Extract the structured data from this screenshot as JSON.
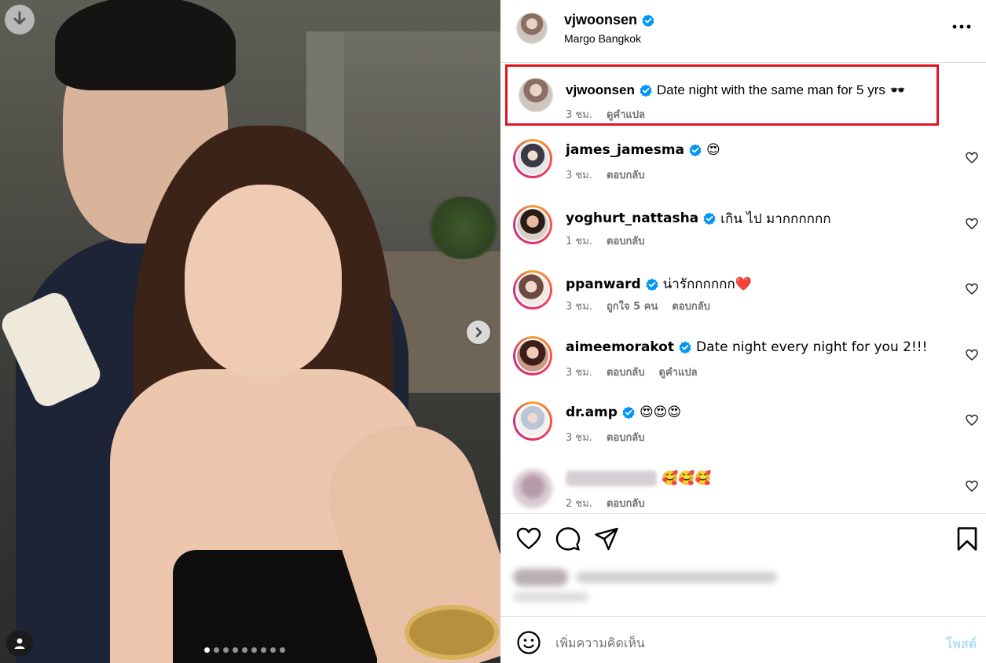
{
  "post": {
    "username": "vjwoonsen",
    "location": "Margo Bangkok",
    "verified": true
  },
  "photo": {
    "carousel_total": 9,
    "carousel_active": 1,
    "icons": [
      "download-icon",
      "chevron-right-icon",
      "user-icon"
    ]
  },
  "caption": {
    "username": "vjwoonsen",
    "text": "Date night with the same man for 5 yrs",
    "emoji": "🕶️",
    "time": "3 ชม.",
    "translate": "ดูคำแปล"
  },
  "comments": [
    {
      "username": "james_jamesma",
      "verified": true,
      "text": "😍",
      "time": "3 ชม.",
      "actions": [
        "ตอบกลับ"
      ]
    },
    {
      "username": "yoghurt_nattasha",
      "verified": true,
      "text": "เกิน ไป มากกกกกก",
      "time": "1 ชม.",
      "actions": [
        "ตอบกลับ"
      ]
    },
    {
      "username": "ppanward",
      "verified": true,
      "text": "น่ารักกกกกก❤️",
      "time": "3 ชม.",
      "actions": [
        "ถูกใจ 5 คน",
        "ตอบกลับ"
      ]
    },
    {
      "username": "aimeemorakot",
      "verified": true,
      "text": "Date night every night for you 2!!!",
      "time": "3 ชม.",
      "actions": [
        "ตอบกลับ",
        "ดูคำแปล"
      ]
    },
    {
      "username": "dr.amp",
      "verified": true,
      "text": "😍😍😍",
      "time": "3 ชม.",
      "actions": [
        "ตอบกลับ"
      ]
    },
    {
      "username": "",
      "verified": false,
      "text": "🥰🥰🥰",
      "time": "2 ชม.",
      "actions": [
        "ตอบกลับ"
      ]
    }
  ],
  "composer": {
    "placeholder": "เพิ่มความคิดเห็น",
    "post_label": "โพสต์"
  },
  "colors": {
    "verified_blue": "#0095f6",
    "highlight_red": "#e0141e",
    "post_disabled": "#b2dffc"
  }
}
